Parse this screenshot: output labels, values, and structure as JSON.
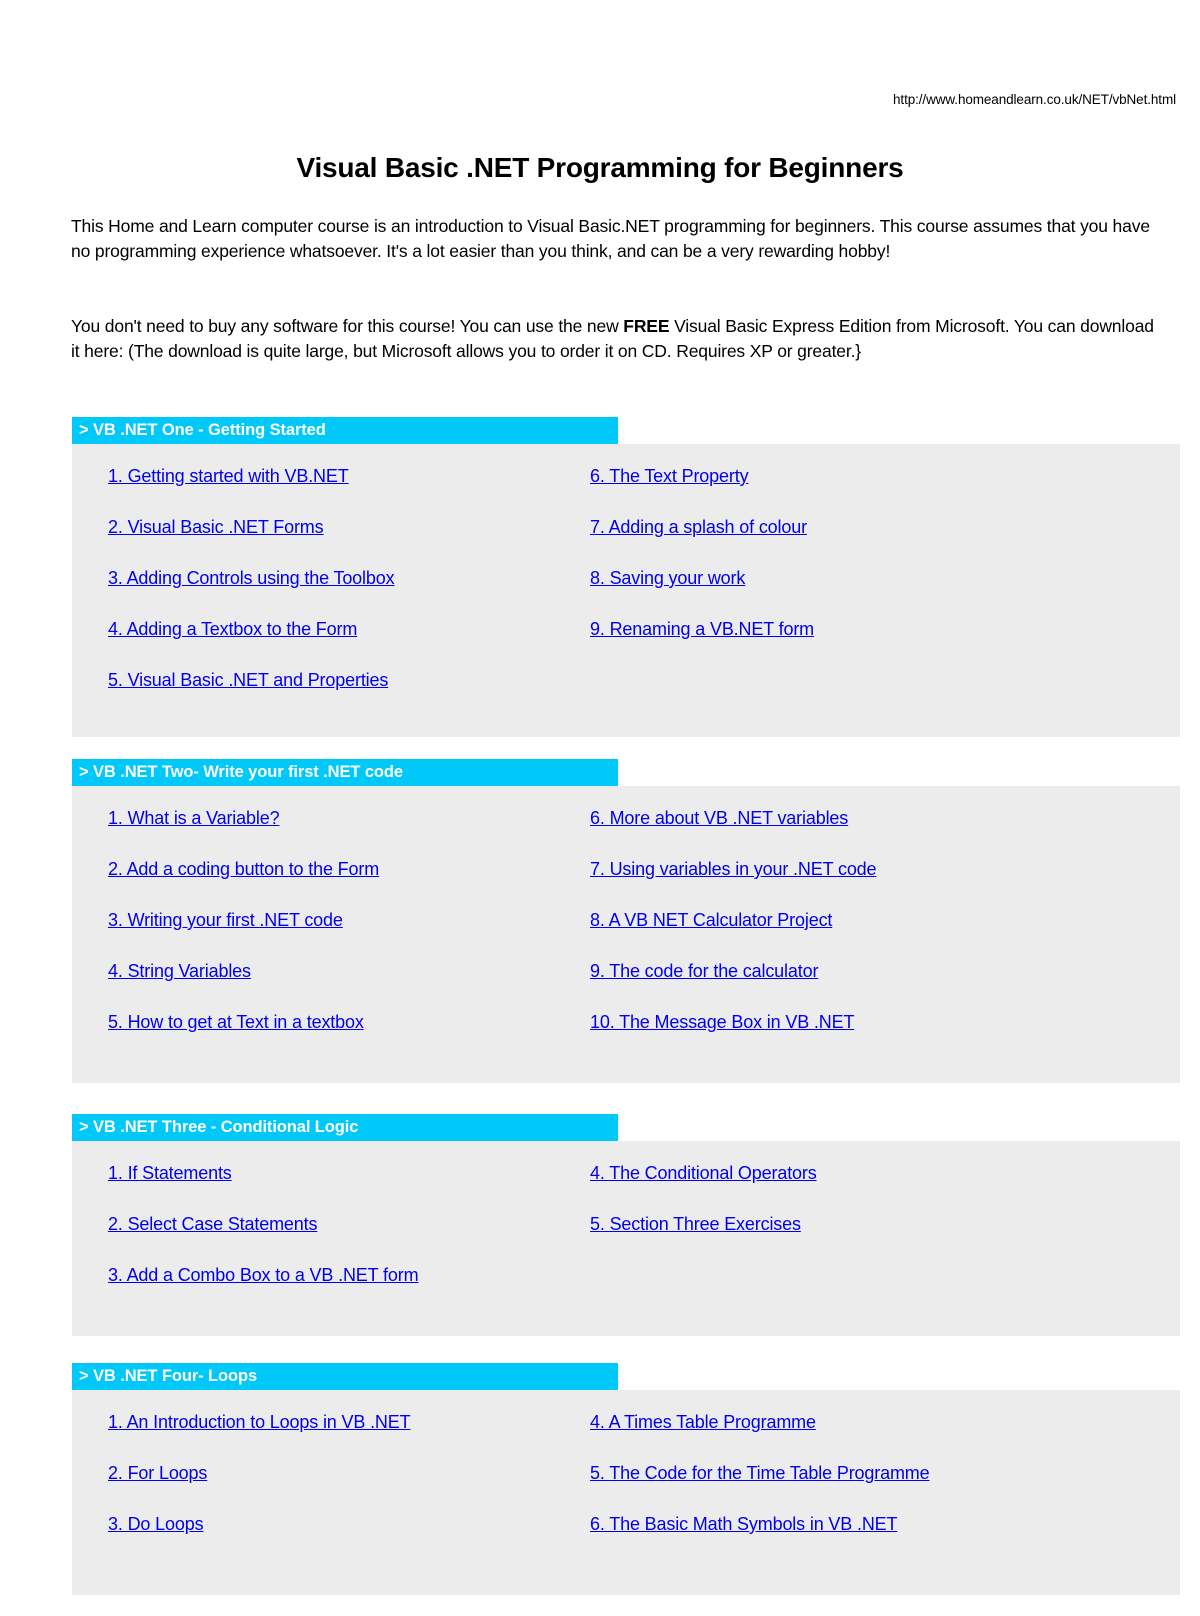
{
  "url": "http://www.homeandlearn.co.uk/NET/vbNet.html",
  "title": "Visual Basic .NET Programming for Beginners",
  "intro": {
    "paragraph1": "This Home and Learn computer course is an introduction to Visual Basic.NET programming for beginners. This course assumes that you have no programming experience whatsoever. It's a lot easier than you think, and can be a very rewarding hobby!",
    "paragraph2_part1": "You don't need to buy any software for this course! You can use the new ",
    "paragraph2_bold": "FREE",
    "paragraph2_part2": " Visual Basic Express Edition from Microsoft. You can download it here: (The download is quite large, but Microsoft allows you to order it on CD. Requires XP or greater.}"
  },
  "colors": {
    "bar": "#00c8f8",
    "panel": "#ececec",
    "link": "#0000ee",
    "bar_text": "#ffffff"
  },
  "sections": [
    {
      "heading": "> VB .NET One - Getting Started",
      "left": [
        "1. Getting started with VB.NET",
        "2. Visual Basic .NET Forms",
        "3. Adding Controls using the Toolbox",
        "4. Adding a Textbox to the Form",
        "5. Visual Basic .NET and Properties"
      ],
      "right": [
        "6. The Text Property",
        "7. Adding a splash of colour",
        "8. Saving your work",
        "9. Renaming a VB.NET form"
      ]
    },
    {
      "heading": "> VB .NET Two- Write your first .NET code",
      "left": [
        "1. What is a Variable?",
        "2. Add a coding button to the Form",
        "3. Writing your first .NET code",
        "4. String Variables",
        "5. How to get at Text in a textbox"
      ],
      "right": [
        "6. More about VB .NET variables",
        "7. Using variables in your .NET code",
        "8. A VB NET Calculator Project",
        "9. The code for the calculator",
        "10. The Message Box in VB .NET"
      ]
    },
    {
      "heading": "> VB .NET Three - Conditional Logic",
      "left": [
        "1. If Statements",
        "2. Select Case Statements",
        "3. Add a Combo Box to a VB .NET form"
      ],
      "right": [
        "4. The Conditional Operators",
        "5. Section Three Exercises"
      ]
    },
    {
      "heading": "> VB .NET Four- Loops",
      "left": [
        "1. An Introduction to Loops in VB .NET",
        "2. For Loops",
        "3. Do Loops"
      ],
      "right": [
        "4. A Times Table Programme",
        "5. The Code for the Time Table Programme",
        "6. The Basic Math Symbols in VB .NET"
      ]
    }
  ]
}
